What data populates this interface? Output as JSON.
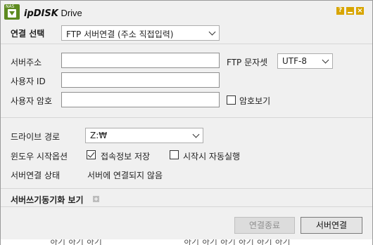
{
  "window": {
    "logo_text": "NAS",
    "title_brand": "ipDISK",
    "title_product": " Drive",
    "help_label": "?",
    "close_label": "×"
  },
  "connection": {
    "label": "연결 선택",
    "selected": "FTP 서버연결 (주소 직접입력)"
  },
  "server": {
    "address_label": "서버주소",
    "address_value": "",
    "charset_label": "FTP 문자셋",
    "charset_selected": "UTF-8",
    "user_id_label": "사용자 ID",
    "user_id_value": "",
    "password_label": "사용자 암호",
    "password_value": "",
    "show_password_label": "암호보기",
    "show_password_checked": false
  },
  "drive": {
    "letter_label": "드라이브 경로",
    "letter_selected": "Z:₩",
    "startup_label": "윈도우 시작옵션",
    "save_info_label": "접속정보 저장",
    "save_info_checked": true,
    "auto_run_label": "시작시 자동실행",
    "auto_run_checked": false,
    "status_label": "서버연결 상태",
    "status_value": "서버에 연결되지 않음"
  },
  "sync_section": {
    "label": "서버쓰기동기화 보기"
  },
  "footer": {
    "disconnect_label": "연결종료",
    "connect_label": "서버연결"
  },
  "behind": {
    "left_text": "하기 하기 하기",
    "right_text": "하기 하기 하기 하기 하기 하기"
  }
}
